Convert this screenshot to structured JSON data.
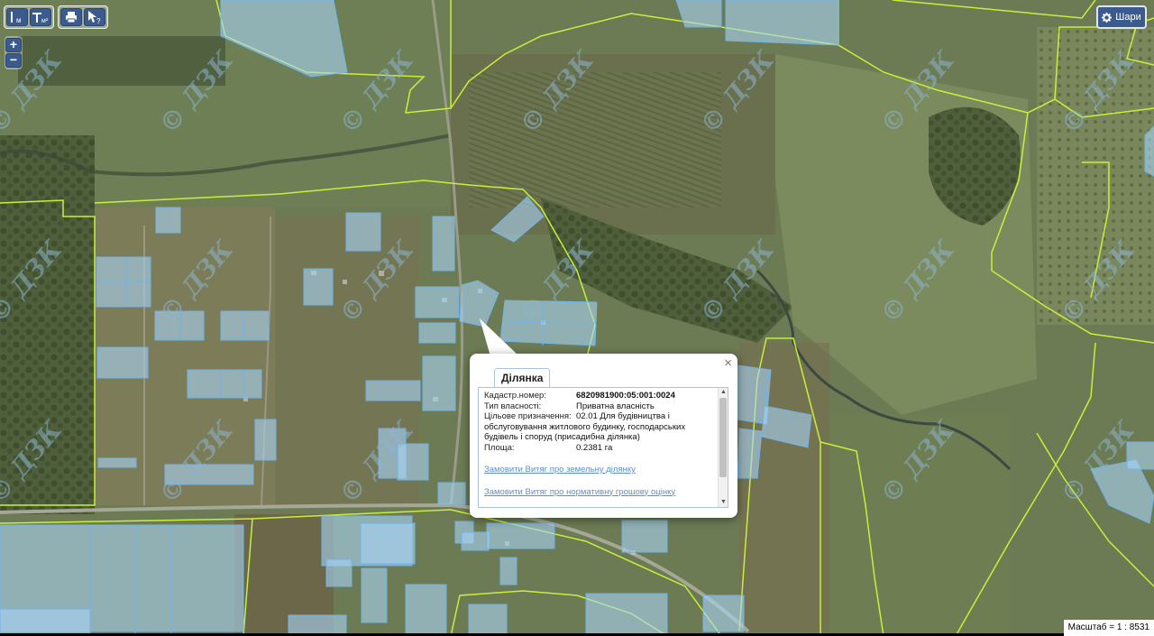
{
  "toolbar": {
    "measure_length_label": "м",
    "measure_area_label": "м²",
    "print_icon": "printer-icon",
    "identify_icon": "cursor-question-icon"
  },
  "zoom": {
    "in_label": "+",
    "out_label": "−"
  },
  "layers": {
    "label": "Шари",
    "icon": "gear-icon"
  },
  "watermark": "© ДЗК",
  "popup": {
    "tab_label": "Ділянка",
    "close_label": "×",
    "fields": [
      {
        "label": "Кадастр.номер:",
        "value": "6820981900:05:001:0024",
        "bold": true
      },
      {
        "label": "Тип власності:",
        "value": "Приватна власність",
        "bold": false
      },
      {
        "label": "Цільове призначення:",
        "value": "02.01 Для будівництва і обслуговування житлового будинку, господарських будівель і споруд (присадибна ділянка)",
        "bold": false
      },
      {
        "label": "Площа:",
        "value": "0.2381 га",
        "bold": false
      }
    ],
    "links": [
      "Замовити Витяг про земельну ділянку",
      "Замовити Витяг про нормативну грошову оцінку"
    ]
  },
  "scale": {
    "label": "Масштаб = 1 : 8531"
  },
  "colors": {
    "parcel_fill": "#a9d4f5",
    "parcel_stroke": "#6fb4ea",
    "boundary": "#c8f03a",
    "button": "#3b5b8f"
  }
}
